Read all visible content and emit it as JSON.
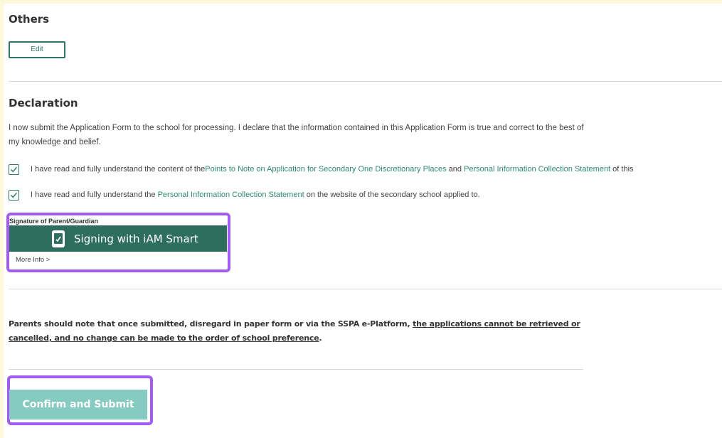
{
  "others": {
    "title": "Others",
    "edit_label": "Edit"
  },
  "declaration": {
    "title": "Declaration",
    "text": "I now submit the Application Form to the school for processing. I declare that the information contained in this Application Form is true and correct to the best of my knowledge and belief.",
    "checks": [
      {
        "checked": true,
        "pre": "I have read and fully understand the content of the ",
        "link1": "Points to Note on Application for Secondary One Discretionary Places",
        "mid": " and ",
        "link2": "Personal Information Collection Statement",
        "post": " of this"
      },
      {
        "checked": true,
        "pre": "I have read and fully understand the ",
        "link1": "Personal Information Collection Statement",
        "post": " on the website of the secondary school applied to."
      }
    ]
  },
  "signature": {
    "label": "Signature of Parent/Guardian",
    "button_label": "Signing with iAM Smart",
    "more_info": "More Info >"
  },
  "notice": {
    "plain": "Parents should note that once submitted, disregard in paper form or via the SSPA e-Platform, ",
    "underlined": "the applications cannot be retrieved or cancelled, and no change can be made to the order of school preference",
    "end": "."
  },
  "submit": {
    "label": "Confirm and Submit"
  },
  "colors": {
    "brand_green": "#2e6e5f",
    "link_green": "#2e8a73",
    "highlight_purple": "#a15cf0",
    "submit_disabled": "#86cbc1"
  },
  "icons": {
    "checkbox": "check-icon",
    "iam_smart": "iam-smart-phone-icon"
  }
}
